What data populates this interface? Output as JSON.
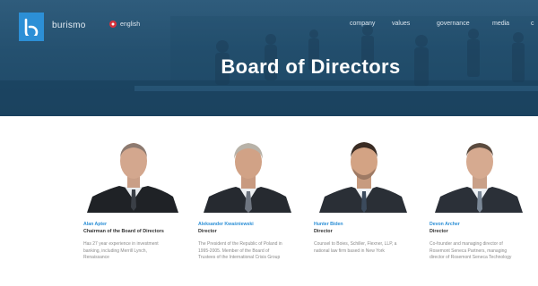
{
  "header": {
    "brand": "burismo",
    "language": "english",
    "nav": [
      "company",
      "values",
      "governance",
      "media",
      "c"
    ]
  },
  "hero": {
    "title": "Board of Directors"
  },
  "people": [
    {
      "name": "Alan Apter",
      "role": "Chairman of the Board of Directors",
      "bio": "Has 27 year experience in investment banking, including Merrill Lynch, Renaissance"
    },
    {
      "name": "Aleksander Kwaśniewski",
      "role": "Director",
      "bio": "The President of the Republic of Poland in 1995-2005. Member of the Board of Trustees of the International Crisis Group"
    },
    {
      "name": "Hunter Biden",
      "role": "Director",
      "bio": "Counsel to Boies, Schiller, Flexner, LLP, a national law firm based in New York"
    },
    {
      "name": "Devon Archer",
      "role": "Director",
      "bio": "Co-founder and managing director of Rosemont Seneca Partners, managing director of Rosemont Seneca Technology"
    }
  ],
  "colors": {
    "accent": "#2c8fd6",
    "hero": "#24506f",
    "name": "#2c8fd6",
    "role": "#333333",
    "bio": "#8a8a8a"
  }
}
